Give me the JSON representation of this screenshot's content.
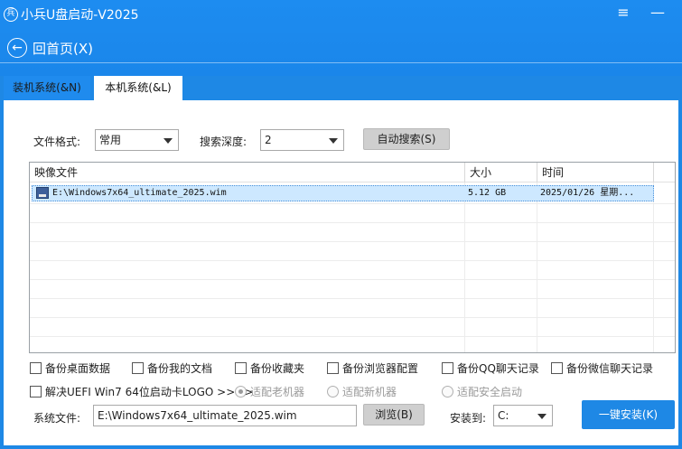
{
  "window": {
    "logo_text": "兵",
    "title": "小兵U盘启动-V2025",
    "menu_icon": "≡",
    "minimize_icon": "—"
  },
  "nav": {
    "back_icon": "←",
    "back_label": "回首页(X)"
  },
  "tabs": [
    {
      "label": "装机系统(&N)"
    },
    {
      "label": "本机系统(&L)"
    }
  ],
  "filters": {
    "format_label": "文件格式:",
    "format_value": "常用",
    "depth_label": "搜索深度:",
    "depth_value": "2",
    "auto_search_label": "自动搜索(S)"
  },
  "table": {
    "columns": [
      "映像文件",
      "大小",
      "时间"
    ],
    "rows": [
      {
        "file": "E:\\Windows7x64_ultimate_2025.wim",
        "size": "5.12 GB",
        "time": "2025/01/26 星期..."
      }
    ]
  },
  "backups": [
    {
      "label": "备份桌面数据"
    },
    {
      "label": "备份我的文档"
    },
    {
      "label": "备份收藏夹"
    },
    {
      "label": "备份浏览器配置"
    },
    {
      "label": "备份QQ聊天记录"
    },
    {
      "label": "备份微信聊天记录"
    }
  ],
  "uefi": {
    "label": "解决UEFI Win7 64位启动卡LOGO >>>>",
    "opt_old": "适配老机器",
    "opt_new": "适配新机器",
    "opt_secure": "适配安全启动"
  },
  "bottom": {
    "sysfile_label": "系统文件:",
    "sysfile_value": "E:\\Windows7x64_ultimate_2025.wim",
    "browse_label": "浏览(B)",
    "install_to_label": "安装到:",
    "install_to_value": "C:",
    "one_click_label": "一键安装(K)"
  }
}
